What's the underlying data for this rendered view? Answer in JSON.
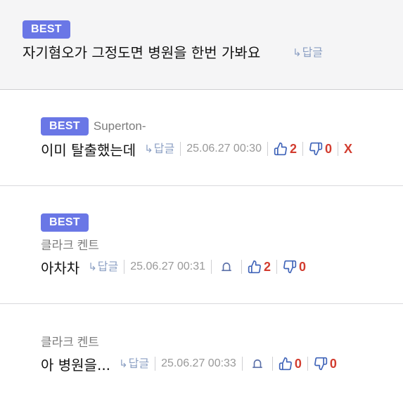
{
  "top_comment": {
    "badge": "BEST",
    "text": "자기혐오가 그정도면 병원을 한번 가봐요",
    "reply_arrow": "↳",
    "reply_label": "답글"
  },
  "comments": [
    {
      "badge": "BEST",
      "author": "Superton-",
      "text": "이미 탈출했는데",
      "reply_arrow": "↳",
      "reply_label": "답글",
      "date": "25.06.27 00:30",
      "likes": "2",
      "dislikes": "0",
      "delete_label": "X"
    },
    {
      "badge": "BEST",
      "author": "클라크 켄트",
      "text": "아차차",
      "reply_arrow": "↳",
      "reply_label": "답글",
      "date": "25.06.27 00:31",
      "likes": "2",
      "dislikes": "0"
    },
    {
      "author": "클라크 켄트",
      "text": "아 병원을...",
      "reply_arrow": "↳",
      "reply_label": "답글",
      "date": "25.06.27 00:33",
      "likes": "0",
      "dislikes": "0"
    }
  ],
  "colors": {
    "badge": "#6a77e6",
    "reply": "#8b9fc3",
    "vote_icon": "#3f63b8",
    "count": "#d23c2f"
  },
  "icons": {
    "like": "thumbs-up-icon",
    "dislike": "thumbs-down-icon",
    "report": "bell-icon",
    "reply": "reply-arrow-icon"
  }
}
